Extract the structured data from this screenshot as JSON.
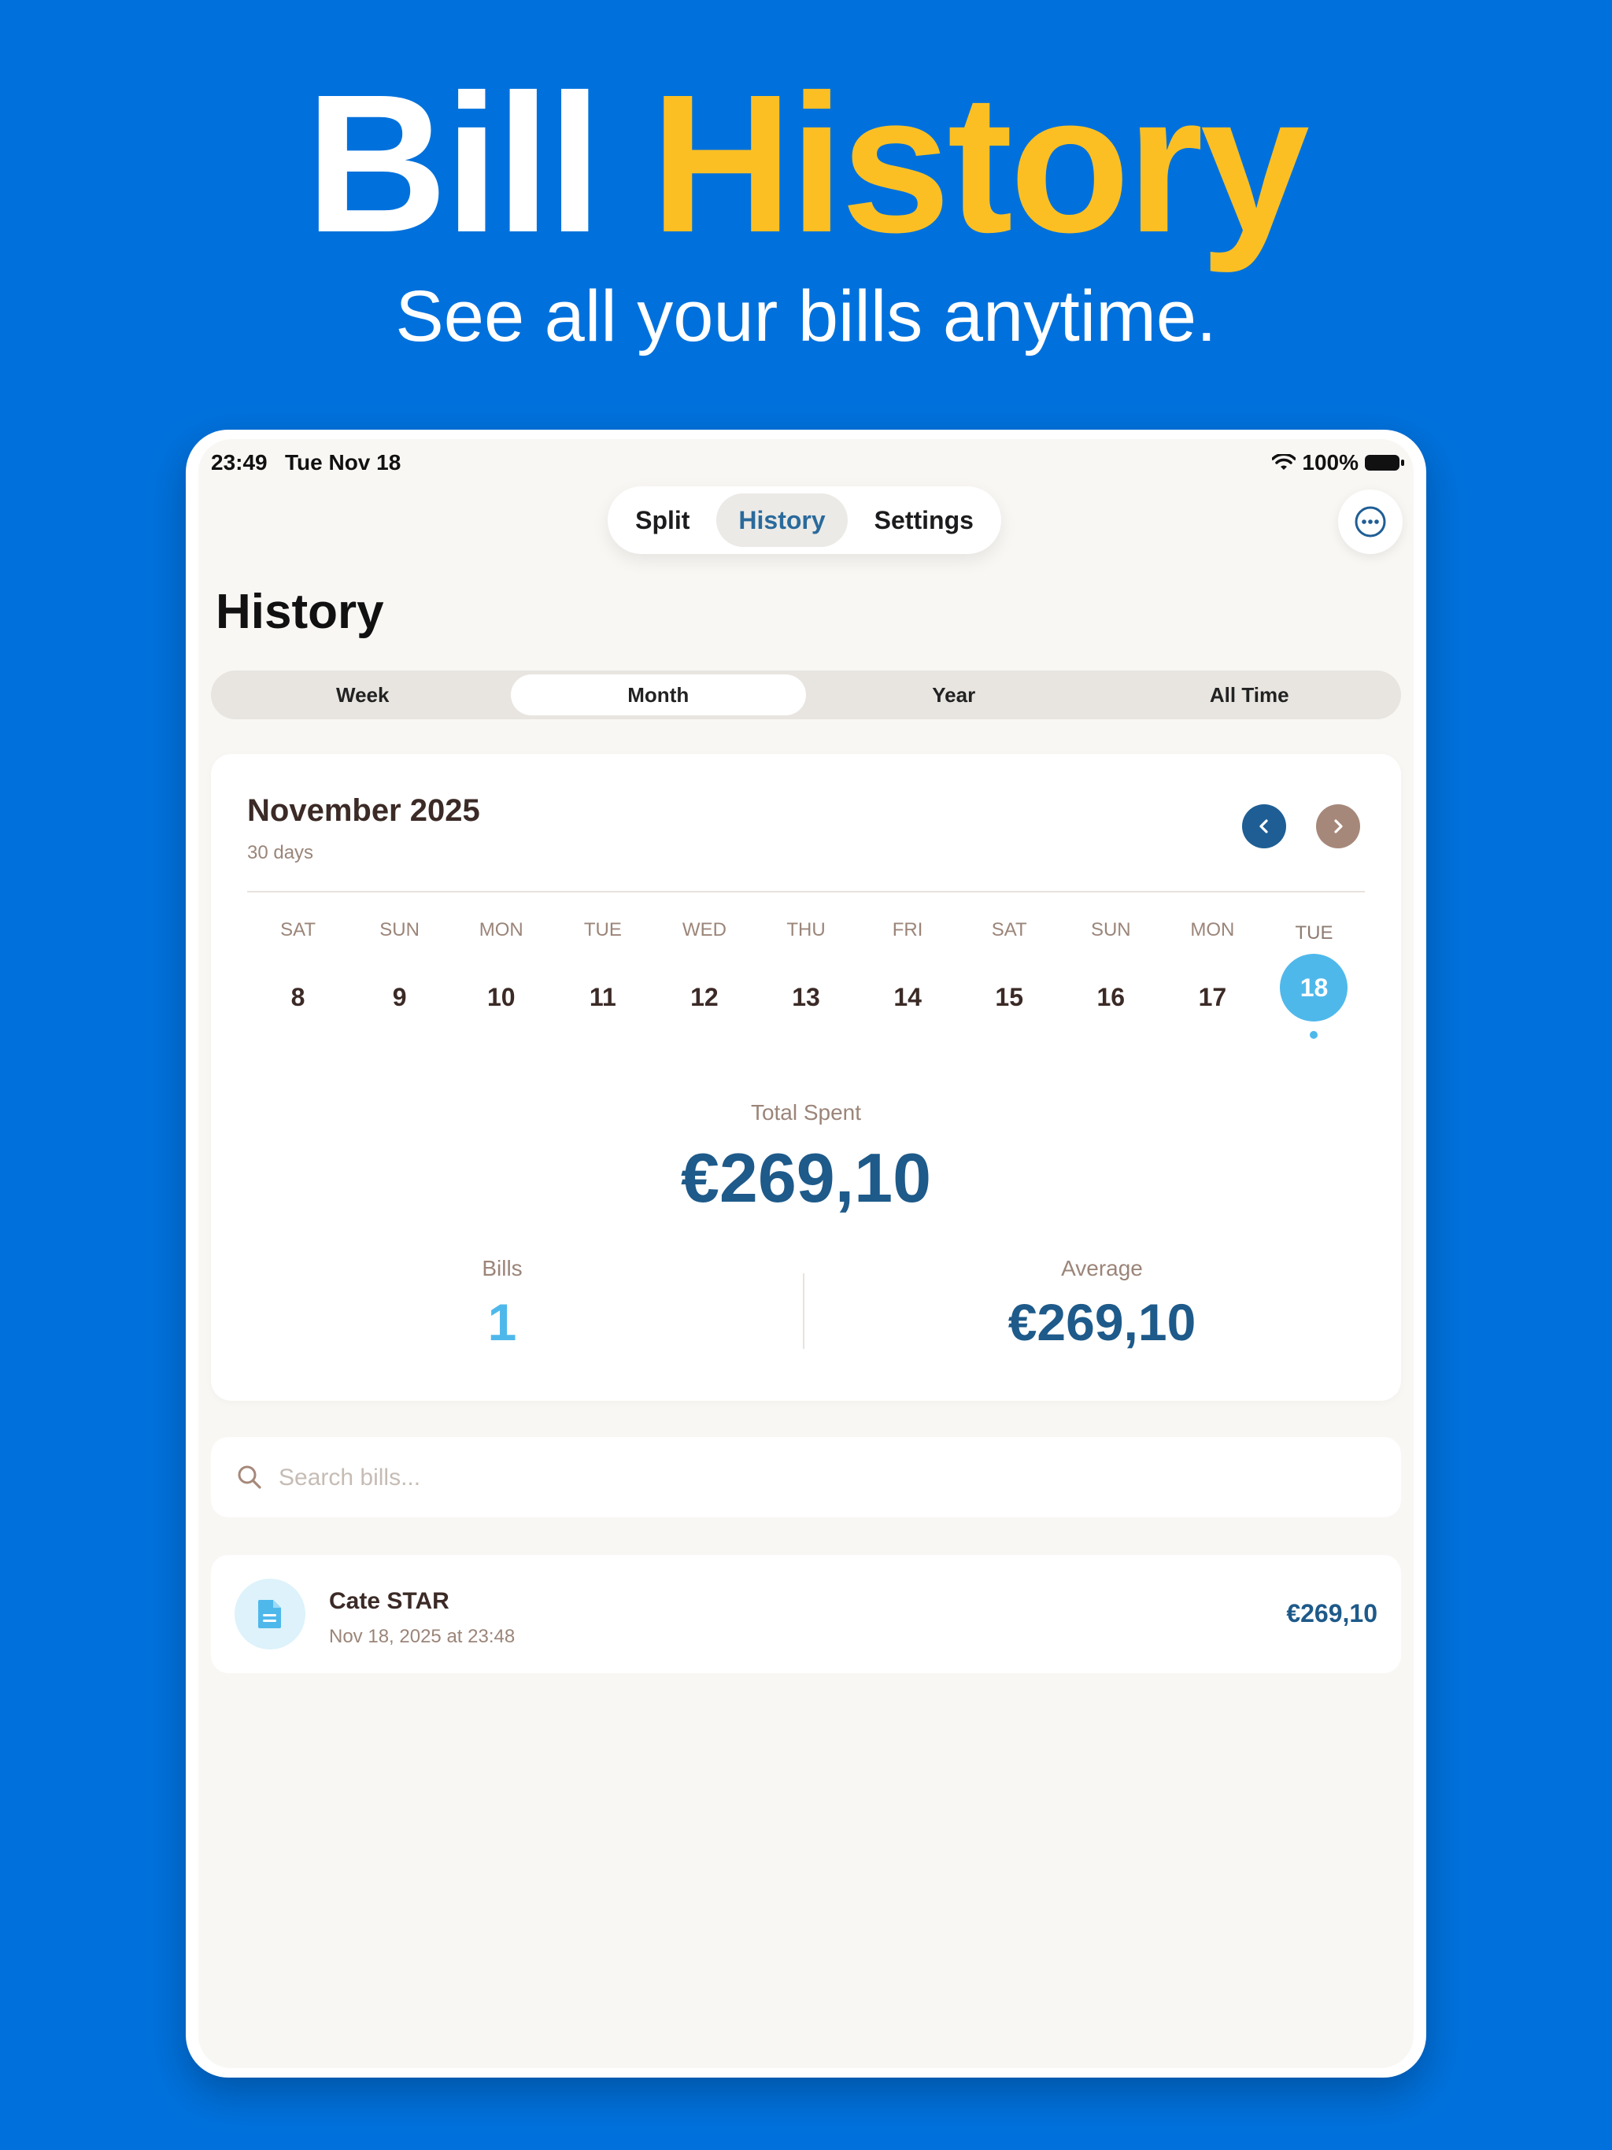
{
  "promo": {
    "title_part1": "Bill",
    "title_part2": "History",
    "subtitle": "See all your bills anytime.",
    "colors": {
      "background": "#0071DC",
      "highlight": "#FBBF24"
    }
  },
  "status_bar": {
    "time": "23:49",
    "date": "Tue Nov 18",
    "battery": "100%"
  },
  "nav": {
    "tabs": [
      {
        "label": "Split",
        "active": false
      },
      {
        "label": "History",
        "active": true
      },
      {
        "label": "Settings",
        "active": false
      }
    ],
    "more_icon": "ellipsis-circle-icon"
  },
  "page_title": "History",
  "period_filter": {
    "options": [
      "Week",
      "Month",
      "Year",
      "All Time"
    ],
    "selected": "Month"
  },
  "calendar": {
    "month_title": "November 2025",
    "days_count": "30 days",
    "days": [
      {
        "dow": "SAT",
        "num": "8"
      },
      {
        "dow": "SUN",
        "num": "9"
      },
      {
        "dow": "MON",
        "num": "10"
      },
      {
        "dow": "TUE",
        "num": "11"
      },
      {
        "dow": "WED",
        "num": "12"
      },
      {
        "dow": "THU",
        "num": "13"
      },
      {
        "dow": "FRI",
        "num": "14"
      },
      {
        "dow": "SAT",
        "num": "15"
      },
      {
        "dow": "SUN",
        "num": "16"
      },
      {
        "dow": "MON",
        "num": "17"
      },
      {
        "dow": "TUE",
        "num": "18",
        "selected": true,
        "has_bill": true
      }
    ]
  },
  "summary": {
    "total_label": "Total Spent",
    "total_value": "€269,10",
    "bills_label": "Bills",
    "bills_value": "1",
    "average_label": "Average",
    "average_value": "€269,10"
  },
  "search": {
    "placeholder": "Search bills...",
    "value": ""
  },
  "bills": [
    {
      "title": "Cate STAR",
      "date": "Nov 18, 2025 at 23:48",
      "amount": "€269,10",
      "icon": "document-icon"
    }
  ]
}
